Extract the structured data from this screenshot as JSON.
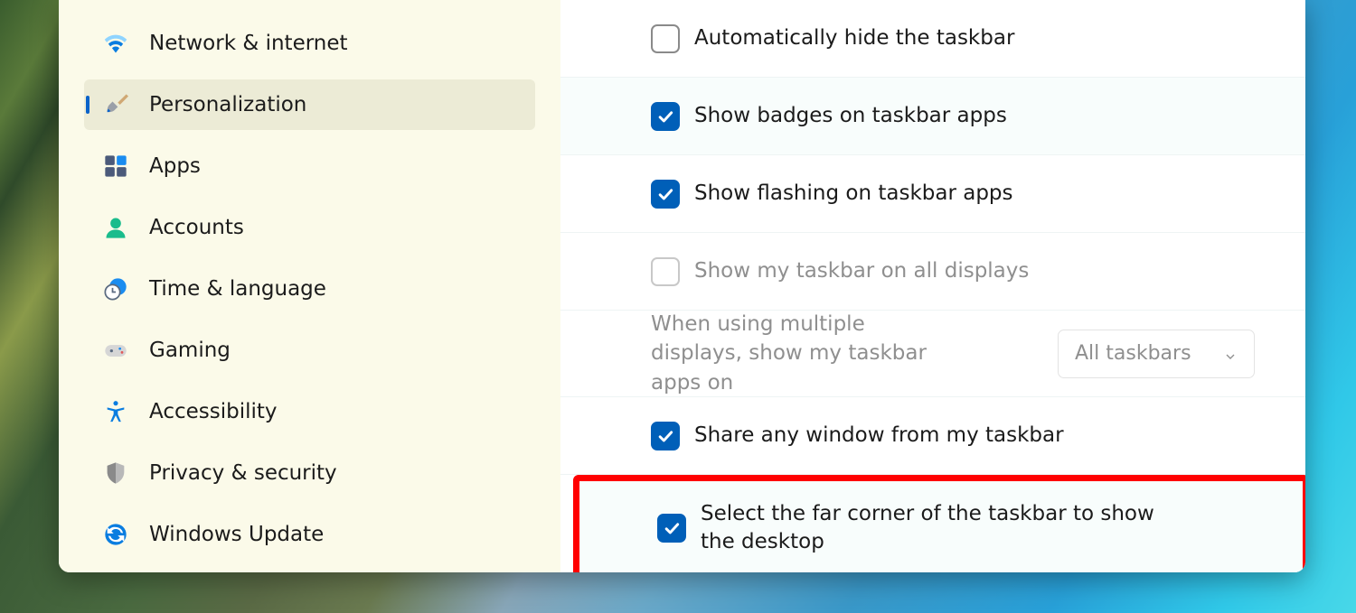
{
  "colors": {
    "accent": "#005fb8",
    "highlight": "#ff0000"
  },
  "sidebar": {
    "items": [
      {
        "key": "network",
        "label": "Network & internet"
      },
      {
        "key": "personalize",
        "label": "Personalization",
        "selected": true
      },
      {
        "key": "apps",
        "label": "Apps"
      },
      {
        "key": "accounts",
        "label": "Accounts"
      },
      {
        "key": "time",
        "label": "Time & language"
      },
      {
        "key": "gaming",
        "label": "Gaming"
      },
      {
        "key": "access",
        "label": "Accessibility"
      },
      {
        "key": "privacy",
        "label": "Privacy & security"
      },
      {
        "key": "update",
        "label": "Windows Update"
      }
    ]
  },
  "settings": {
    "auto_hide": {
      "label": "Automatically hide the taskbar",
      "checked": false
    },
    "badges": {
      "label": "Show badges on taskbar apps",
      "checked": true
    },
    "flashing": {
      "label": "Show flashing on taskbar apps",
      "checked": true
    },
    "all_displays": {
      "label": "Show my taskbar on all displays",
      "checked": false,
      "disabled": true
    },
    "multi": {
      "label": "When using multiple displays, show my taskbar apps on"
    },
    "share": {
      "label": "Share any window from my taskbar",
      "checked": true
    },
    "far_corner": {
      "label": "Select the far corner of the taskbar to show the desktop",
      "checked": true
    }
  },
  "dropdown": {
    "multi_displays": {
      "selected": "All taskbars"
    }
  }
}
